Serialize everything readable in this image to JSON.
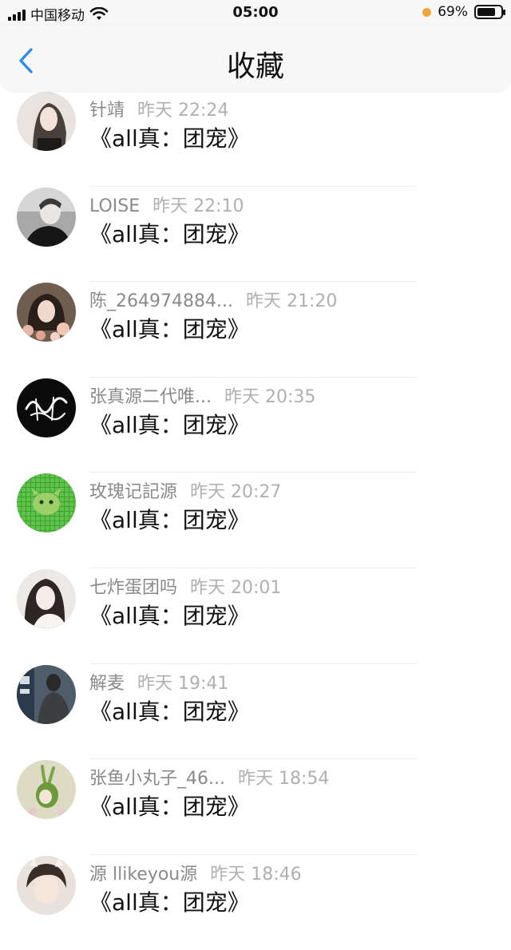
{
  "status_bar": {
    "carrier": "中国移动",
    "time": "05:00",
    "battery": "69%"
  },
  "nav": {
    "title": "收藏",
    "back_icon": "chevron-left-icon"
  },
  "colors": {
    "accent": "#2f8fe6",
    "battery_dot": "#f3a43b"
  },
  "items": [
    {
      "name": "针靖",
      "time": "昨天 22:24",
      "content": "《all真：团宠》"
    },
    {
      "name": "LOISE",
      "time": "昨天 22:10",
      "content": "《all真：团宠》"
    },
    {
      "name": "陈_264974884...",
      "time": "昨天 21:20",
      "content": "《all真：团宠》"
    },
    {
      "name": "张真源二代唯...",
      "time": "昨天 20:35",
      "content": "《all真：团宠》"
    },
    {
      "name": "玫瑰记記源",
      "time": "昨天 20:27",
      "content": "《all真：团宠》"
    },
    {
      "name": "七炸蛋团吗",
      "time": "昨天 20:01",
      "content": "《all真：团宠》"
    },
    {
      "name": "解麦",
      "time": "昨天 19:41",
      "content": "《all真：团宠》"
    },
    {
      "name": "张鱼小丸子_46...",
      "time": "昨天 18:54",
      "content": "《all真：团宠》"
    },
    {
      "name": "源 llikeyou源",
      "time": "昨天 18:46",
      "content": "《all真：团宠》"
    }
  ]
}
